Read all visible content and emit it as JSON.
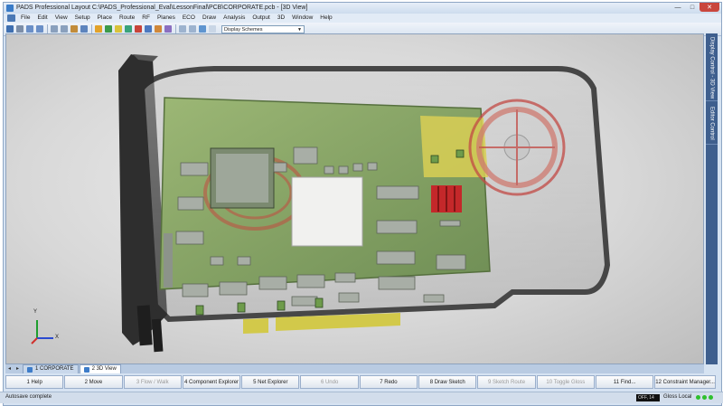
{
  "window": {
    "title": "PADS Professional Layout  C:\\PADS_Professional_Eval\\LessonFinal\\PCB\\CORPORATE.pcb - [3D View]",
    "minimize_glyph": "—",
    "maximize_glyph": "□",
    "close_glyph": "✕"
  },
  "menubar": {
    "items": [
      "File",
      "Edit",
      "View",
      "Setup",
      "Place",
      "Route",
      "RF",
      "Planes",
      "ECO",
      "Draw",
      "Analysis",
      "Output",
      "3D",
      "Window",
      "Help"
    ]
  },
  "toolbar": {
    "display_scheme": "Display Schemes"
  },
  "side_panel": {
    "tabs": [
      "Display Control - 3D View",
      "Editor Control"
    ]
  },
  "axes": {
    "x": "X",
    "y": "Y"
  },
  "document_tabs": {
    "nav_left": "◂",
    "nav_right": "▸",
    "items": [
      {
        "label": "1 CORPORATE",
        "active": false
      },
      {
        "label": "2 3D View",
        "active": true
      }
    ]
  },
  "function_keys": [
    {
      "label": "1 Help",
      "enabled": true
    },
    {
      "label": "2 Move",
      "enabled": true
    },
    {
      "label": "3 Flow / Walk",
      "enabled": false
    },
    {
      "label": "4 Component Explorer",
      "enabled": true
    },
    {
      "label": "5 Net Explorer",
      "enabled": true
    },
    {
      "label": "6 Undo",
      "enabled": false
    },
    {
      "label": "7 Redo",
      "enabled": true
    },
    {
      "label": "8 Draw Sketch",
      "enabled": true
    },
    {
      "label": "9 Sketch Route",
      "enabled": false
    },
    {
      "label": "10 Toggle Gloss",
      "enabled": false
    },
    {
      "label": "11 Find...",
      "enabled": true
    },
    {
      "label": "12 Constraint Manager...",
      "enabled": true
    }
  ],
  "statusbar": {
    "message": "Autosave complete",
    "coordinates": "OFF, 14",
    "gloss": "Gloss Local"
  },
  "colors": {
    "board": "#8aa866",
    "bracket": "#2b2b2b",
    "gold_fingers": "#d2c94a",
    "accent_red": "#d0302c"
  }
}
